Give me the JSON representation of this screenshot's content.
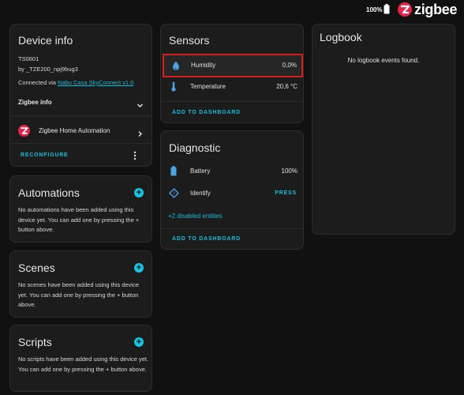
{
  "topbar": {
    "battery_text": "100%",
    "brand": "zigbee"
  },
  "device_info": {
    "title": "Device info",
    "model": "TS0601",
    "manufacturer": "by _TZE200_npj9bug3",
    "connected_prefix": "Connected via ",
    "connected_link": "Nabu Casa SkyConnect v1.0",
    "zigbee_info_label": "Zigbee info",
    "integration_label": "Zigbee Home Automation",
    "reconfigure_label": "RECONFIGURE"
  },
  "automations": {
    "title": "Automations",
    "text": "No automations have been added using this device yet. You can add one by pressing the + button above."
  },
  "scenes": {
    "title": "Scenes",
    "text": "No scenes have been added using this device yet. You can add one by pressing the + button above."
  },
  "scripts": {
    "title": "Scripts",
    "text": "No scripts have been added using this device yet. You can add one by pressing the + button above."
  },
  "sensors": {
    "title": "Sensors",
    "rows": [
      {
        "label": "Humidity",
        "value": "0,0%",
        "icon": "water-drop-icon"
      },
      {
        "label": "Temperature",
        "value": "20,6 °C",
        "icon": "thermometer-icon"
      }
    ],
    "add_label": "ADD TO DASHBOARD"
  },
  "diagnostic": {
    "title": "Diagnostic",
    "rows": [
      {
        "label": "Battery",
        "value": "100%",
        "icon": "battery-icon"
      },
      {
        "label": "Identify",
        "value": "PRESS",
        "icon": "identify-icon"
      }
    ],
    "disabled_entities": "+2 disabled entities",
    "add_label": "ADD TO DASHBOARD"
  },
  "logbook": {
    "title": "Logbook",
    "empty_text": "No logbook events found."
  },
  "colors": {
    "accent": "#18bcd8",
    "highlight_border": "#d61f1f",
    "zigbee_red": "#e5234b"
  }
}
